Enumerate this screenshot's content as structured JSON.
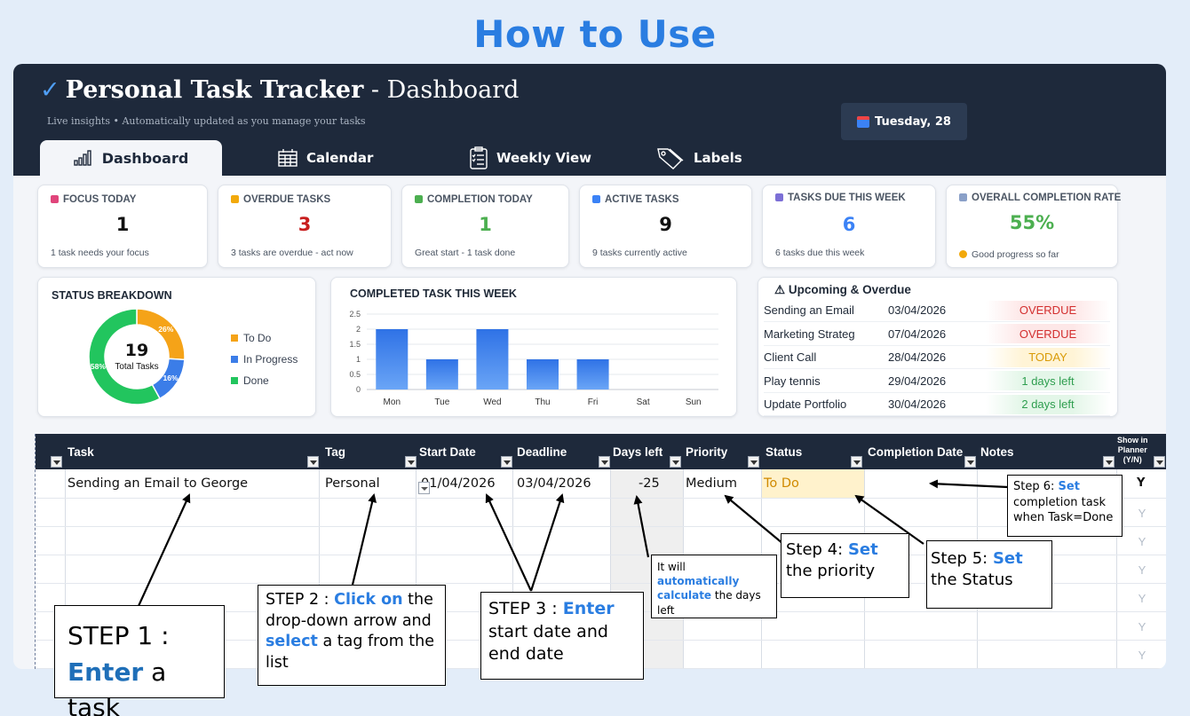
{
  "page_title": "How to Use",
  "app": {
    "check": "✓",
    "title_bold": "Personal Task Tracker",
    "title_rest": " - Dashboard",
    "subtitle": "Live insights • Automatically updated as you manage your tasks",
    "date": "Tuesday, 28"
  },
  "tabs": [
    {
      "label": "Dashboard",
      "icon": "bar-chart-icon"
    },
    {
      "label": "Calendar",
      "icon": "calendar-icon"
    },
    {
      "label": "Weekly View",
      "icon": "clipboard-icon"
    },
    {
      "label": "Labels",
      "icon": "tag-icon"
    }
  ],
  "kpis": [
    {
      "label": "FOCUS TODAY",
      "value": "1",
      "note": "1 task needs your focus",
      "color": "#111111",
      "icon_color": "#e0457b"
    },
    {
      "label": "OVERDUE TASKS",
      "value": "3",
      "note": "3 tasks are overdue - act now",
      "color": "#c81e1e",
      "icon_color": "#f2a90b"
    },
    {
      "label": "COMPLETION TODAY",
      "value": "1",
      "note": "Great start - 1 task done",
      "color": "#4caf50",
      "icon_color": "#4caf50"
    },
    {
      "label": "ACTIVE TASKS",
      "value": "9",
      "note": "9 tasks currently active",
      "color": "#111111",
      "icon_color": "#3b82f6"
    },
    {
      "label": "TASKS DUE THIS WEEK",
      "value": "6",
      "note": "6 tasks due this week",
      "color": "#3b82f6",
      "icon_color": "#7c6fd6"
    },
    {
      "label": "OVERALL COMPLETION RATE",
      "value": "55%",
      "note": "Good progress so far",
      "color": "#4caf50",
      "icon_color": "#8aa0c8"
    }
  ],
  "status_breakdown": {
    "title": "STATUS BREAKDOWN",
    "total": "19",
    "total_label": "Total Tasks",
    "slices": [
      {
        "name": "To Do",
        "percent": 26,
        "label": "26%",
        "color": "#f5a318"
      },
      {
        "name": "In Progress",
        "percent": 16,
        "label": "16%",
        "color": "#3b7de8"
      },
      {
        "name": "Done",
        "percent": 58,
        "label": "58%",
        "color": "#22c55e"
      }
    ]
  },
  "chart_data": {
    "type": "bar",
    "title": "COMPLETED TASK THIS WEEK",
    "categories": [
      "Mon",
      "Tue",
      "Wed",
      "Thu",
      "Fri",
      "Sat",
      "Sun"
    ],
    "values": [
      2,
      1,
      2,
      1,
      1,
      0,
      0
    ],
    "yticks": [
      "0",
      "0.5",
      "1",
      "1.5",
      "2",
      "2.5"
    ],
    "ylim": [
      0,
      2.5
    ],
    "grid": true,
    "bar_color": "#3b7de8"
  },
  "upcoming": {
    "title": "Upcoming & Overdue",
    "rows": [
      {
        "name": "Sending an Email",
        "date": "03/04/2026",
        "status": "OVERDUE",
        "color": "#d32f2f",
        "bg": "#fde7e7"
      },
      {
        "name": "Marketing Strateg",
        "date": "07/04/2026",
        "status": "OVERDUE",
        "color": "#d32f2f",
        "bg": "#fde7e7"
      },
      {
        "name": "Client Call",
        "date": "28/04/2026",
        "status": "TODAY",
        "color": "#d99a06",
        "bg": "#fff4d6"
      },
      {
        "name": "Play tennis",
        "date": "29/04/2026",
        "status": "1 days left",
        "color": "#2e9e4f",
        "bg": "#e3f6e8"
      },
      {
        "name": "Update Portfolio",
        "date": "30/04/2026",
        "status": "2 days left",
        "color": "#2e9e4f",
        "bg": "#e3f6e8"
      }
    ]
  },
  "table": {
    "headers": {
      "task": "Task",
      "tag": "Tag",
      "start": "Start Date",
      "deadline": "Deadline",
      "days": "Days left",
      "priority": "Priority",
      "status": "Status",
      "completion": "Completion Date",
      "notes": "Notes",
      "planner_1": "Show in",
      "planner_2": "Planner",
      "planner_3": "(Y/N)"
    },
    "row1": {
      "task": "Sending an Email to George",
      "tag": "Personal",
      "start": "01/04/2026",
      "deadline": "03/04/2026",
      "days": "-25",
      "priority": "Medium",
      "status": "To Do",
      "planner": "Y"
    },
    "planner_values": [
      "Y",
      "Y",
      "Y",
      "Y",
      "Y",
      "Y"
    ]
  },
  "callouts": {
    "step1": {
      "a": "STEP 1 :",
      "b": "Enter",
      "c": " a task"
    },
    "step2": {
      "a": "STEP 2 : ",
      "b": "Click on",
      "c": " the drop-down arrow and ",
      "d": "select",
      "e": " a tag from the list"
    },
    "step3": {
      "a": "STEP 3 : ",
      "b": "Enter",
      "c": " start date and end date"
    },
    "auto": {
      "a": "It will ",
      "b": "automatically calculate",
      "c": " the days left"
    },
    "step4": {
      "a": "Step 4: ",
      "b": "Set",
      "c": " the priority"
    },
    "step5": {
      "a": "Step 5: ",
      "b": "Set",
      "c": " the Status"
    },
    "step6": {
      "a": "Step 6: ",
      "b": "Set",
      "c": " completion task when Task=Done"
    }
  }
}
